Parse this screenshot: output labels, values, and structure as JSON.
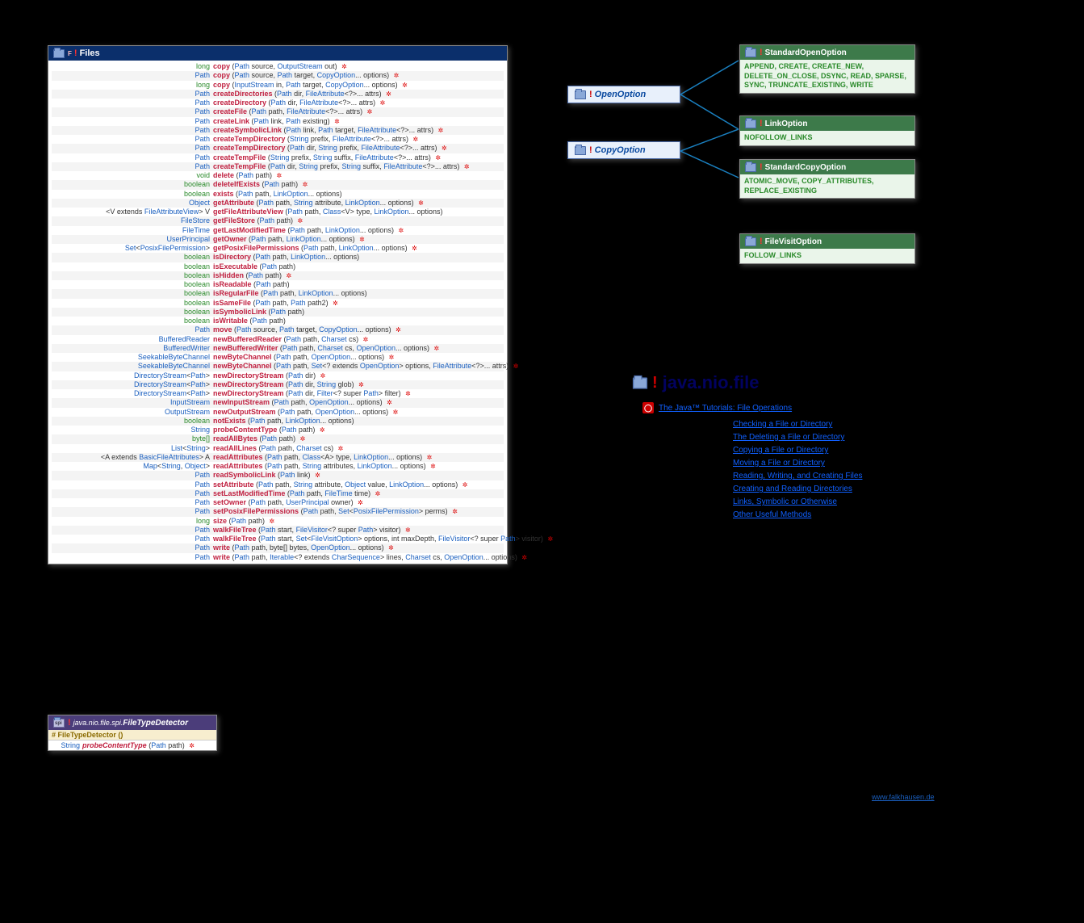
{
  "package_title": "java.nio.file",
  "files_box": {
    "title": "Files",
    "methods": [
      {
        "ret": "<span class='kw'>long</span>",
        "name": "copy",
        "params": "(<span class='ptype'>Path</span> source, <span class='ptype'>OutputStream</span> out)",
        "throws": true
      },
      {
        "ret": "<span class='type'>Path</span>",
        "name": "copy",
        "params": "(<span class='ptype'>Path</span> source, <span class='ptype'>Path</span> target, <span class='ptype'>CopyOption</span>... options)",
        "throws": true
      },
      {
        "ret": "<span class='kw'>long</span>",
        "name": "copy",
        "params": "(<span class='ptype'>InputStream</span> in, <span class='ptype'>Path</span> target, <span class='ptype'>CopyOption</span>... options)",
        "throws": true
      },
      {
        "ret": "<span class='type'>Path</span>",
        "name": "createDirectories",
        "params": "(<span class='ptype'>Path</span> dir, <span class='ptype'>FileAttribute</span>&lt;?&gt;... attrs)",
        "throws": true
      },
      {
        "ret": "<span class='type'>Path</span>",
        "name": "createDirectory",
        "params": "(<span class='ptype'>Path</span> dir, <span class='ptype'>FileAttribute</span>&lt;?&gt;... attrs)",
        "throws": true
      },
      {
        "ret": "<span class='type'>Path</span>",
        "name": "createFile",
        "params": "(<span class='ptype'>Path</span> path, <span class='ptype'>FileAttribute</span>&lt;?&gt;... attrs)",
        "throws": true
      },
      {
        "ret": "<span class='type'>Path</span>",
        "name": "createLink",
        "params": "(<span class='ptype'>Path</span> link, <span class='ptype'>Path</span> existing)",
        "throws": true
      },
      {
        "ret": "<span class='type'>Path</span>",
        "name": "createSymbolicLink",
        "params": "(<span class='ptype'>Path</span> link, <span class='ptype'>Path</span> target, <span class='ptype'>FileAttribute</span>&lt;?&gt;... attrs)",
        "throws": true
      },
      {
        "ret": "<span class='type'>Path</span>",
        "name": "createTempDirectory",
        "params": "(<span class='ptype'>String</span> prefix, <span class='ptype'>FileAttribute</span>&lt;?&gt;... attrs)",
        "throws": true
      },
      {
        "ret": "<span class='type'>Path</span>",
        "name": "createTempDirectory",
        "params": "(<span class='ptype'>Path</span> dir, <span class='ptype'>String</span> prefix, <span class='ptype'>FileAttribute</span>&lt;?&gt;... attrs)",
        "throws": true
      },
      {
        "ret": "<span class='type'>Path</span>",
        "name": "createTempFile",
        "params": "(<span class='ptype'>String</span> prefix, <span class='ptype'>String</span> suffix, <span class='ptype'>FileAttribute</span>&lt;?&gt;... attrs)",
        "throws": true
      },
      {
        "ret": "<span class='type'>Path</span>",
        "name": "createTempFile",
        "params": "(<span class='ptype'>Path</span> dir, <span class='ptype'>String</span> prefix, <span class='ptype'>String</span> suffix, <span class='ptype'>FileAttribute</span>&lt;?&gt;... attrs)",
        "throws": true
      },
      {
        "ret": "<span class='kw'>void</span>",
        "name": "delete",
        "params": "(<span class='ptype'>Path</span> path)",
        "throws": true
      },
      {
        "ret": "<span class='kw'>boolean</span>",
        "name": "deleteIfExists",
        "params": "(<span class='ptype'>Path</span> path)",
        "throws": true
      },
      {
        "ret": "<span class='kw'>boolean</span>",
        "name": "exists",
        "params": "(<span class='ptype'>Path</span> path, <span class='ptype'>LinkOption</span>... options)",
        "throws": false
      },
      {
        "ret": "<span class='type'>Object</span>",
        "name": "getAttribute",
        "params": "(<span class='ptype'>Path</span> path, <span class='ptype'>String</span> attribute, <span class='ptype'>LinkOption</span>... options)",
        "throws": true
      },
      {
        "ret": "<span class='gen'>&lt;V extends </span><span class='type'>FileAttributeView</span><span class='gen'>&gt; V</span>",
        "name": "getFileAttributeView",
        "params": "(<span class='ptype'>Path</span> path, <span class='ptype'>Class</span>&lt;V&gt; type, <span class='ptype'>LinkOption</span>... options)",
        "throws": false
      },
      {
        "ret": "<span class='type'>FileStore</span>",
        "name": "getFileStore",
        "params": "(<span class='ptype'>Path</span> path)",
        "throws": true
      },
      {
        "ret": "<span class='type'>FileTime</span>",
        "name": "getLastModifiedTime",
        "params": "(<span class='ptype'>Path</span> path, <span class='ptype'>LinkOption</span>... options)",
        "throws": true
      },
      {
        "ret": "<span class='type'>UserPrincipal</span>",
        "name": "getOwner",
        "params": "(<span class='ptype'>Path</span> path, <span class='ptype'>LinkOption</span>... options)",
        "throws": true
      },
      {
        "ret": "<span class='type'>Set</span><span class='gen'>&lt;</span><span class='type'>PosixFilePermission</span><span class='gen'>&gt;</span>",
        "name": "getPosixFilePermissions",
        "params": "(<span class='ptype'>Path</span> path, <span class='ptype'>LinkOption</span>... options)",
        "throws": true
      },
      {
        "ret": "<span class='kw'>boolean</span>",
        "name": "isDirectory",
        "params": "(<span class='ptype'>Path</span> path, <span class='ptype'>LinkOption</span>... options)",
        "throws": false
      },
      {
        "ret": "<span class='kw'>boolean</span>",
        "name": "isExecutable",
        "params": "(<span class='ptype'>Path</span> path)",
        "throws": false
      },
      {
        "ret": "<span class='kw'>boolean</span>",
        "name": "isHidden",
        "params": "(<span class='ptype'>Path</span> path)",
        "throws": true
      },
      {
        "ret": "<span class='kw'>boolean</span>",
        "name": "isReadable",
        "params": "(<span class='ptype'>Path</span> path)",
        "throws": false
      },
      {
        "ret": "<span class='kw'>boolean</span>",
        "name": "isRegularFile",
        "params": "(<span class='ptype'>Path</span> path, <span class='ptype'>LinkOption</span>... options)",
        "throws": false
      },
      {
        "ret": "<span class='kw'>boolean</span>",
        "name": "isSameFile",
        "params": "(<span class='ptype'>Path</span> path, <span class='ptype'>Path</span> path2)",
        "throws": true
      },
      {
        "ret": "<span class='kw'>boolean</span>",
        "name": "isSymbolicLink",
        "params": "(<span class='ptype'>Path</span> path)",
        "throws": false
      },
      {
        "ret": "<span class='kw'>boolean</span>",
        "name": "isWritable",
        "params": "(<span class='ptype'>Path</span> path)",
        "throws": false
      },
      {
        "ret": "<span class='type'>Path</span>",
        "name": "move",
        "params": "(<span class='ptype'>Path</span> source, <span class='ptype'>Path</span> target, <span class='ptype'>CopyOption</span>... options)",
        "throws": true
      },
      {
        "ret": "<span class='type'>BufferedReader</span>",
        "name": "newBufferedReader",
        "params": "(<span class='ptype'>Path</span> path, <span class='ptype'>Charset</span> cs)",
        "throws": true
      },
      {
        "ret": "<span class='type'>BufferedWriter</span>",
        "name": "newBufferedWriter",
        "params": "(<span class='ptype'>Path</span> path, <span class='ptype'>Charset</span> cs, <span class='ptype'>OpenOption</span>... options)",
        "throws": true
      },
      {
        "ret": "<span class='type'>SeekableByteChannel</span>",
        "name": "newByteChannel",
        "params": "(<span class='ptype'>Path</span> path, <span class='ptype'>OpenOption</span>... options)",
        "throws": true
      },
      {
        "ret": "<span class='type'>SeekableByteChannel</span>",
        "name": "newByteChannel",
        "params": "(<span class='ptype'>Path</span> path, <span class='ptype'>Set</span>&lt;? extends <span class='ptype'>OpenOption</span>&gt; options, <span class='ptype'>FileAttribute</span>&lt;?&gt;... attrs)",
        "throws": true
      },
      {
        "ret": "<span class='type'>DirectoryStream</span><span class='gen'>&lt;</span><span class='type'>Path</span><span class='gen'>&gt;</span>",
        "name": "newDirectoryStream",
        "params": "(<span class='ptype'>Path</span> dir)",
        "throws": true
      },
      {
        "ret": "<span class='type'>DirectoryStream</span><span class='gen'>&lt;</span><span class='type'>Path</span><span class='gen'>&gt;</span>",
        "name": "newDirectoryStream",
        "params": "(<span class='ptype'>Path</span> dir, <span class='ptype'>String</span> glob)",
        "throws": true
      },
      {
        "ret": "<span class='type'>DirectoryStream</span><span class='gen'>&lt;</span><span class='type'>Path</span><span class='gen'>&gt;</span>",
        "name": "newDirectoryStream",
        "params": "(<span class='ptype'>Path</span> dir, <span class='ptype'>Filter</span>&lt;? super <span class='ptype'>Path</span>&gt; filter)",
        "throws": true
      },
      {
        "ret": "<span class='type'>InputStream</span>",
        "name": "newInputStream",
        "params": "(<span class='ptype'>Path</span> path, <span class='ptype'>OpenOption</span>... options)",
        "throws": true
      },
      {
        "ret": "<span class='type'>OutputStream</span>",
        "name": "newOutputStream",
        "params": "(<span class='ptype'>Path</span> path, <span class='ptype'>OpenOption</span>... options)",
        "throws": true
      },
      {
        "ret": "<span class='kw'>boolean</span>",
        "name": "notExists",
        "params": "(<span class='ptype'>Path</span> path, <span class='ptype'>LinkOption</span>... options)",
        "throws": false
      },
      {
        "ret": "<span class='type'>String</span>",
        "name": "probeContentType",
        "params": "(<span class='ptype'>Path</span> path)",
        "throws": true
      },
      {
        "ret": "<span class='kw'>byte[]</span>",
        "name": "readAllBytes",
        "params": "(<span class='ptype'>Path</span> path)",
        "throws": true
      },
      {
        "ret": "<span class='type'>List</span><span class='gen'>&lt;</span><span class='type'>String</span><span class='gen'>&gt;</span>",
        "name": "readAllLines",
        "params": "(<span class='ptype'>Path</span> path, <span class='ptype'>Charset</span> cs)",
        "throws": true
      },
      {
        "ret": "<span class='gen'>&lt;A extends </span><span class='type'>BasicFileAttributes</span><span class='gen'>&gt; A</span>",
        "name": "readAttributes",
        "params": "(<span class='ptype'>Path</span> path, <span class='ptype'>Class</span>&lt;A&gt; type, <span class='ptype'>LinkOption</span>... options)",
        "throws": true
      },
      {
        "ret": "<span class='type'>Map</span><span class='gen'>&lt;</span><span class='type'>String</span><span class='gen'>, </span><span class='type'>Object</span><span class='gen'>&gt;</span>",
        "name": "readAttributes",
        "params": "(<span class='ptype'>Path</span> path, <span class='ptype'>String</span> attributes, <span class='ptype'>LinkOption</span>... options)",
        "throws": true
      },
      {
        "ret": "<span class='type'>Path</span>",
        "name": "readSymbolicLink",
        "params": "(<span class='ptype'>Path</span> link)",
        "throws": true
      },
      {
        "ret": "<span class='type'>Path</span>",
        "name": "setAttribute",
        "params": "(<span class='ptype'>Path</span> path, <span class='ptype'>String</span> attribute, <span class='ptype'>Object</span> value, <span class='ptype'>LinkOption</span>... options)",
        "throws": true
      },
      {
        "ret": "<span class='type'>Path</span>",
        "name": "setLastModifiedTime",
        "params": "(<span class='ptype'>Path</span> path, <span class='ptype'>FileTime</span> time)",
        "throws": true
      },
      {
        "ret": "<span class='type'>Path</span>",
        "name": "setOwner",
        "params": "(<span class='ptype'>Path</span> path, <span class='ptype'>UserPrincipal</span> owner)",
        "throws": true
      },
      {
        "ret": "<span class='type'>Path</span>",
        "name": "setPosixFilePermissions",
        "params": "(<span class='ptype'>Path</span> path, <span class='ptype'>Set</span>&lt;<span class='ptype'>PosixFilePermission</span>&gt; perms)",
        "throws": true
      },
      {
        "ret": "<span class='kw'>long</span>",
        "name": "size",
        "params": "(<span class='ptype'>Path</span> path)",
        "throws": true
      },
      {
        "ret": "<span class='type'>Path</span>",
        "name": "walkFileTree",
        "params": "(<span class='ptype'>Path</span> start, <span class='ptype'>FileVisitor</span>&lt;? super <span class='ptype'>Path</span>&gt; visitor)",
        "throws": true
      },
      {
        "ret": "<span class='type'>Path</span>",
        "name": "walkFileTree",
        "params": "(<span class='ptype'>Path</span> start, <span class='ptype'>Set</span>&lt;<span class='ptype'>FileVisitOption</span>&gt; options, int maxDepth, <span class='ptype'>FileVisitor</span>&lt;? super <span class='ptype'>Path</span>&gt; visitor)",
        "throws": true
      },
      {
        "ret": "<span class='type'>Path</span>",
        "name": "write",
        "params": "(<span class='ptype'>Path</span> path, byte[] bytes, <span class='ptype'>OpenOption</span>... options)",
        "throws": true
      },
      {
        "ret": "<span class='type'>Path</span>",
        "name": "write",
        "params": "(<span class='ptype'>Path</span> path, <span class='ptype'>Iterable</span>&lt;? extends <span class='ptype'>CharSequence</span>&gt; lines, <span class='ptype'>Charset</span> cs, <span class='ptype'>OpenOption</span>... options)",
        "throws": true
      }
    ]
  },
  "open_option": {
    "name": "OpenOption"
  },
  "copy_option": {
    "name": "CopyOption"
  },
  "std_open": {
    "title": "StandardOpenOption",
    "values": "APPEND, CREATE, CREATE_NEW, DELETE_ON_CLOSE, DSYNC, READ, SPARSE, SYNC, TRUNCATE_EXISTING, WRITE"
  },
  "link_opt": {
    "title": "LinkOption",
    "values": "NOFOLLOW_LINKS"
  },
  "std_copy": {
    "title": "StandardCopyOption",
    "values": "ATOMIC_MOVE, COPY_ATTRIBUTES, REPLACE_EXISTING"
  },
  "fvo": {
    "title": "FileVisitOption",
    "values": "FOLLOW_LINKS"
  },
  "tutorial": {
    "header": "The Java™ Tutorials: File Operations",
    "links": [
      "Checking a File or Directory",
      "The Deleting a File or Directory",
      "Copying a File or Directory",
      "Moving a File or Directory",
      "Reading, Writing, and Creating Files",
      "Creating and Reading Directories",
      "Links, Symbolic or Otherwise",
      "Other Useful Methods"
    ]
  },
  "ftd": {
    "pkg": "java.nio.file.spi.",
    "title": "FileTypeDetector",
    "ctor": "# FileTypeDetector ()",
    "method_ret": "String",
    "method_name": "probeContentType",
    "method_params": "(Path path)"
  },
  "watermark": "www.falkhausen.de"
}
